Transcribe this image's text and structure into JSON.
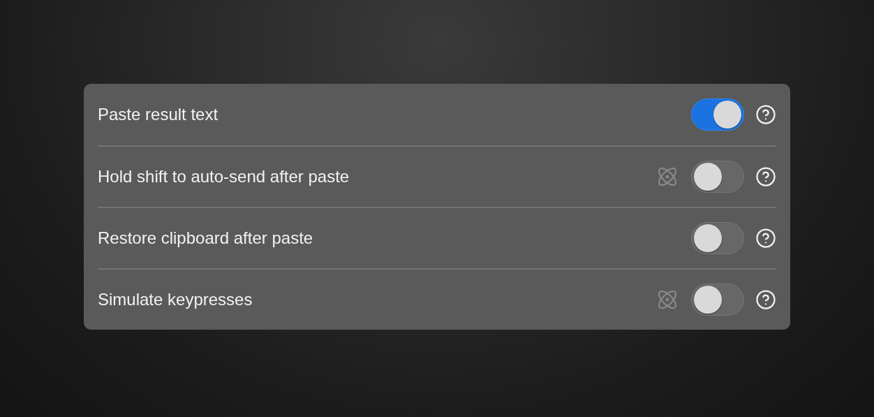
{
  "settings": [
    {
      "label": "Paste result text",
      "on": true,
      "atom_icon": false
    },
    {
      "label": "Hold shift to auto-send after paste",
      "on": false,
      "atom_icon": true
    },
    {
      "label": "Restore clipboard after paste",
      "on": false,
      "atom_icon": false
    },
    {
      "label": "Simulate keypresses",
      "on": false,
      "atom_icon": true
    }
  ]
}
